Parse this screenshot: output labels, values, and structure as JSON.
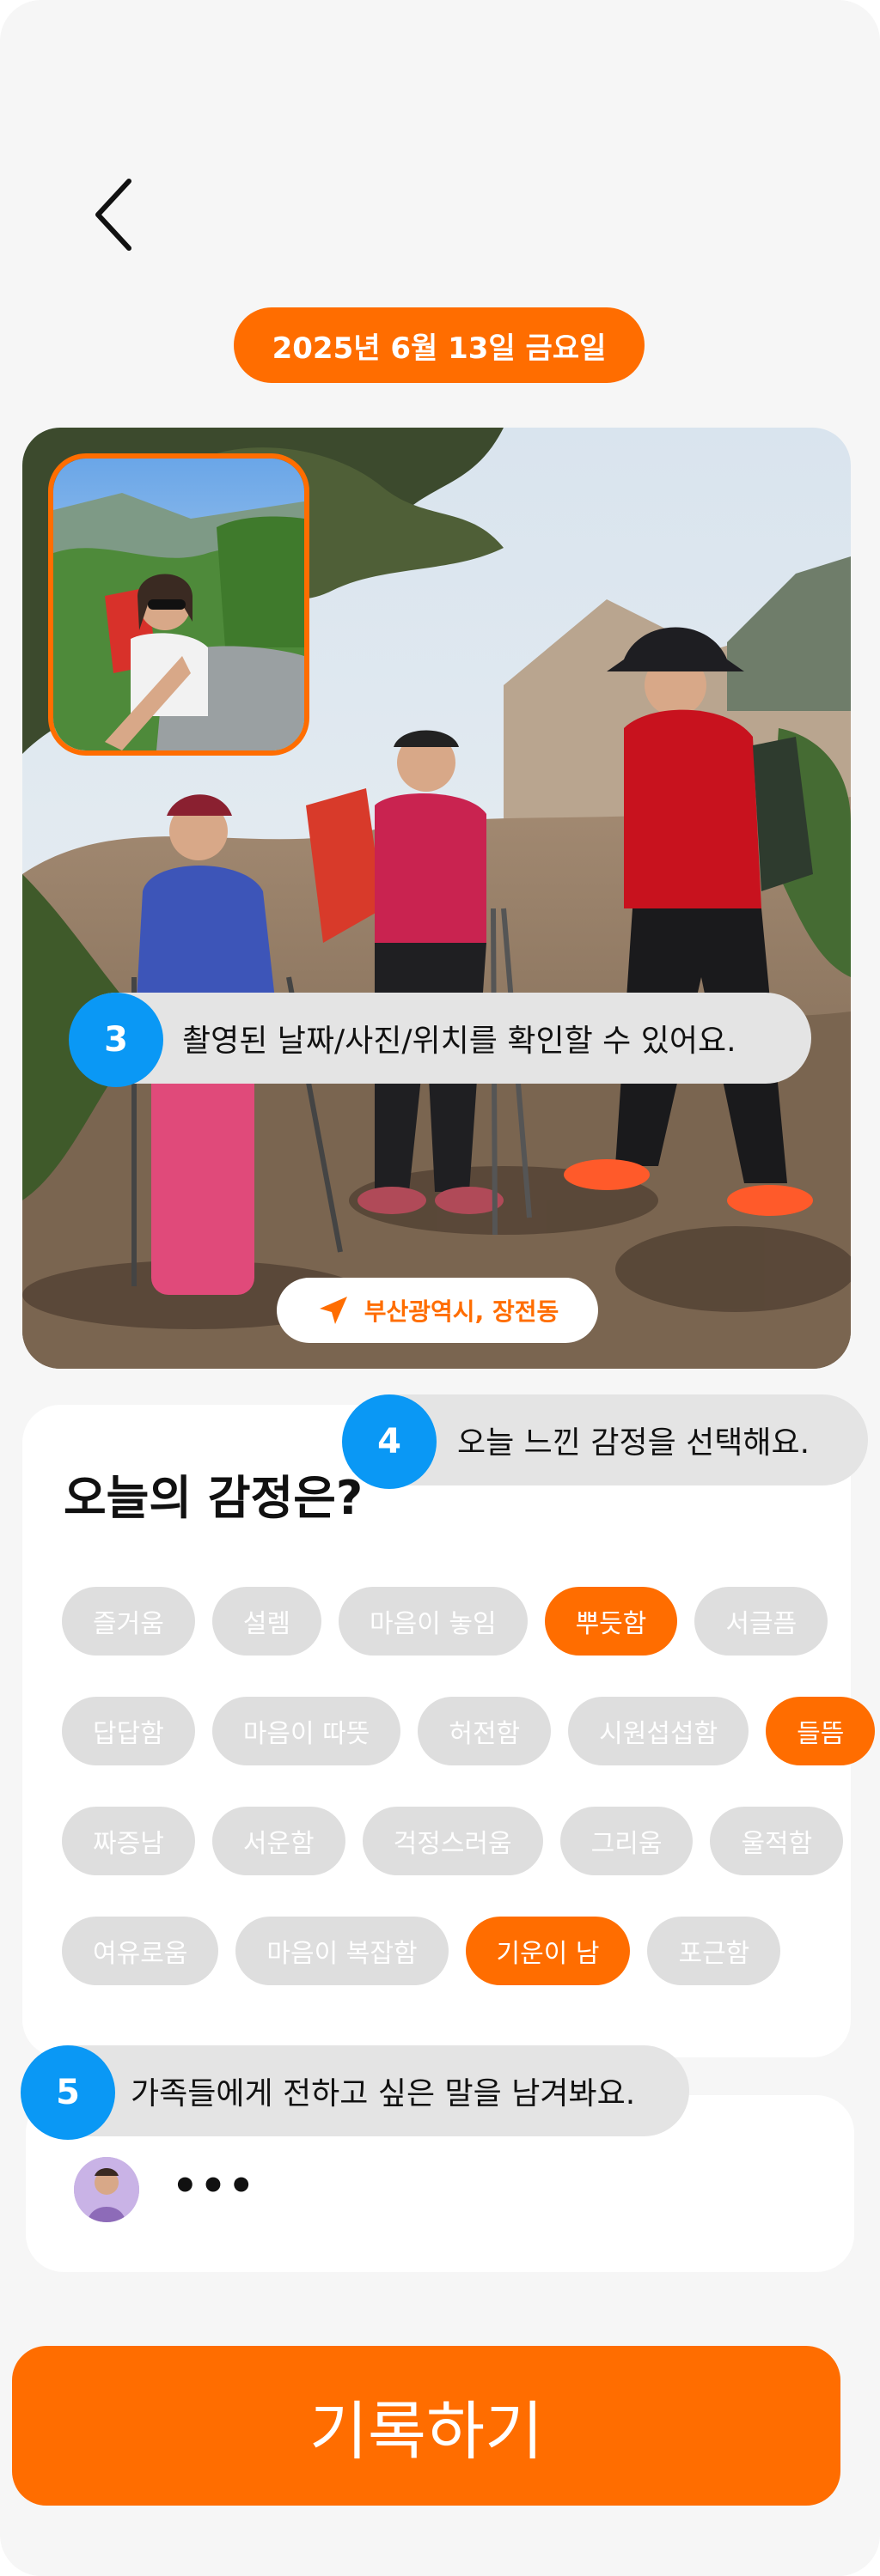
{
  "header": {
    "back_icon": "chevron-left-icon",
    "date": "2025년 6월 13일 금요일"
  },
  "photo": {
    "main_photo_subject": "hikers-on-rocky-mountain",
    "inset_photo_subject": "hiker-selfie",
    "location": "부산광역시, 장전동",
    "location_icon": "navigation-arrow-icon"
  },
  "tips": [
    {
      "number": "3",
      "text": "촬영된 날짜/사진/위치를 확인할 수 있어요."
    },
    {
      "number": "4",
      "text": "오늘 느낀 감정을 선택해요."
    },
    {
      "number": "5",
      "text": "가족들에게 전하고 싶은 말을 남겨봐요."
    }
  ],
  "emotion": {
    "title": "오늘의 감정은?",
    "rows": [
      [
        {
          "label": "즐거움",
          "selected": false
        },
        {
          "label": "설렘",
          "selected": false
        },
        {
          "label": "마음이 놓임",
          "selected": false
        },
        {
          "label": "뿌듯함",
          "selected": true
        },
        {
          "label": "서글픔",
          "selected": false
        }
      ],
      [
        {
          "label": "답답함",
          "selected": false
        },
        {
          "label": "마음이 따뜻",
          "selected": false
        },
        {
          "label": "허전함",
          "selected": false
        },
        {
          "label": "시원섭섭함",
          "selected": false
        },
        {
          "label": "들뜸",
          "selected": true
        }
      ],
      [
        {
          "label": "짜증남",
          "selected": false
        },
        {
          "label": "서운함",
          "selected": false
        },
        {
          "label": "걱정스러움",
          "selected": false
        },
        {
          "label": "그리움",
          "selected": false
        },
        {
          "label": "울적함",
          "selected": false
        }
      ],
      [
        {
          "label": "여유로움",
          "selected": false
        },
        {
          "label": "마음이 복잡함",
          "selected": false
        },
        {
          "label": "기운이 남",
          "selected": true
        },
        {
          "label": "포근함",
          "selected": false
        }
      ]
    ]
  },
  "message": {
    "placeholder": "•••",
    "avatar": "user-avatar"
  },
  "submit": {
    "label": "기록하기"
  },
  "colors": {
    "accent": "#ff6d00",
    "tip_number": "#0a98f5",
    "chip_inactive": "#dedede",
    "background": "#f6f6f6"
  }
}
